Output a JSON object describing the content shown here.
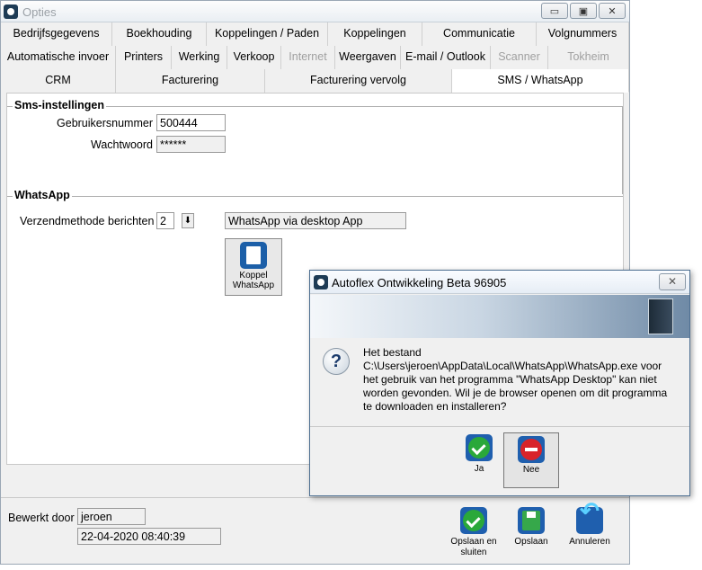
{
  "window": {
    "title": "Opties",
    "min_glyph": "▭",
    "max_glyph": "▣",
    "close_glyph": "✕"
  },
  "tabs_row1": [
    "Bedrijfsgegevens",
    "Boekhouding",
    "Koppelingen / Paden",
    "Koppelingen",
    "Communicatie",
    "Volgnummers"
  ],
  "tabs_row2": [
    "Automatische invoer",
    "Printers",
    "Werking",
    "Verkoop",
    "Internet",
    "Weergaven",
    "E-mail / Outlook",
    "Scanner",
    "Tokheim"
  ],
  "tabs_row3": [
    "CRM",
    "Facturering",
    "Facturering vervolg",
    "SMS / WhatsApp"
  ],
  "sms": {
    "title": "Sms-instellingen",
    "user_label": "Gebruikersnummer",
    "user_value": "500444",
    "pass_label": "Wachtwoord",
    "pass_value": "******"
  },
  "whatsapp": {
    "title": "WhatsApp",
    "method_label": "Verzendmethode berichten",
    "method_value": "2",
    "method_text": "WhatsApp via desktop App",
    "koppel_label": "Koppel WhatsApp"
  },
  "footer": {
    "edited_by_label": "Bewerkt door",
    "edited_by_value": "jeroen",
    "datetime": "22-04-2020 08:40:39",
    "save_close": "Opslaan en sluiten",
    "save": "Opslaan",
    "cancel": "Annuleren"
  },
  "dialog": {
    "title": "Autoflex Ontwikkeling Beta 96905",
    "message_l1": "Het bestand",
    "message_l2": "C:\\Users\\jeroen\\AppData\\Local\\WhatsApp\\WhatsApp.exe voor",
    "message_l3": "het gebruik van het programma \"WhatsApp Desktop\" kan niet",
    "message_l4": "worden gevonden. Wil je de browser openen om dit programma",
    "message_l5": "te downloaden en installeren?",
    "yes": "Ja",
    "no": "Nee",
    "close_glyph": "✕"
  }
}
